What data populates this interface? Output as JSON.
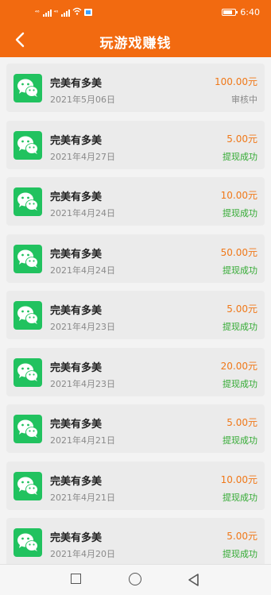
{
  "status_bar": {
    "signal_label_1": "⁴⁶",
    "signal_label_2": "⁴⁶",
    "time": "6:40"
  },
  "header": {
    "title": "玩游戏赚钱"
  },
  "colors": {
    "brand_orange": "#f26a10",
    "wechat_green": "#21c25f",
    "amount_orange": "#f07818",
    "success_green": "#33aa33",
    "pending_gray": "#8a8a8a"
  },
  "records": [
    {
      "name": "完美有多美",
      "date": "2021年5月06日",
      "amount": "100.00元",
      "status": "审核中",
      "status_type": "pending"
    },
    {
      "name": "完美有多美",
      "date": "2021年4月27日",
      "amount": "5.00元",
      "status": "提现成功",
      "status_type": "success"
    },
    {
      "name": "完美有多美",
      "date": "2021年4月24日",
      "amount": "10.00元",
      "status": "提现成功",
      "status_type": "success"
    },
    {
      "name": "完美有多美",
      "date": "2021年4月24日",
      "amount": "50.00元",
      "status": "提现成功",
      "status_type": "success"
    },
    {
      "name": "完美有多美",
      "date": "2021年4月23日",
      "amount": "5.00元",
      "status": "提现成功",
      "status_type": "success"
    },
    {
      "name": "完美有多美",
      "date": "2021年4月23日",
      "amount": "20.00元",
      "status": "提现成功",
      "status_type": "success"
    },
    {
      "name": "完美有多美",
      "date": "2021年4月21日",
      "amount": "5.00元",
      "status": "提现成功",
      "status_type": "success"
    },
    {
      "name": "完美有多美",
      "date": "2021年4月21日",
      "amount": "10.00元",
      "status": "提现成功",
      "status_type": "success"
    },
    {
      "name": "完美有多美",
      "date": "2021年4月20日",
      "amount": "5.00元",
      "status": "提现成功",
      "status_type": "success"
    }
  ]
}
